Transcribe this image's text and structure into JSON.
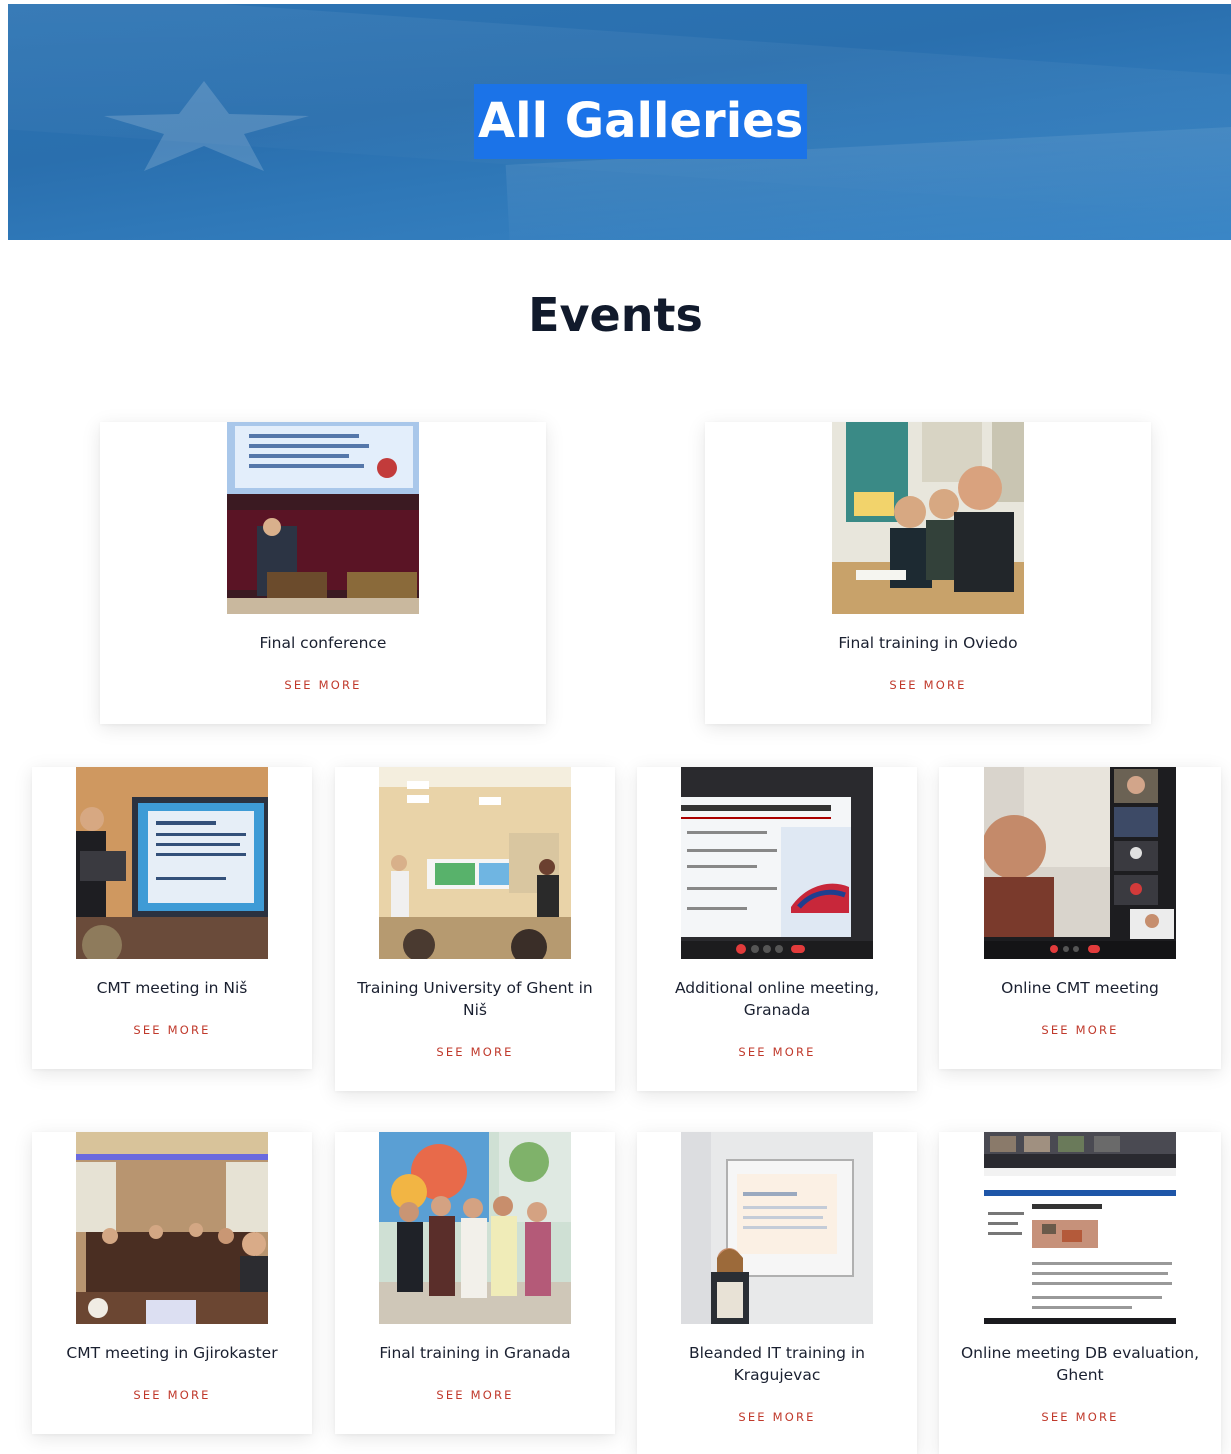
{
  "hero": {
    "title": "All Galleries"
  },
  "section": {
    "title": "Events"
  },
  "events": [
    {
      "title": "Final conference",
      "link": "SEE MORE",
      "image_icon": "conference-photo"
    },
    {
      "title": "Final training in Oviedo",
      "link": "SEE MORE",
      "image_icon": "group-photo"
    },
    {
      "title": "CMT meeting in Niš",
      "link": "SEE MORE",
      "image_icon": "presentation-photo"
    },
    {
      "title": "Training University of Ghent in Niš",
      "link": "SEE MORE",
      "image_icon": "classroom-photo"
    },
    {
      "title": "Additional online meeting, Granada",
      "link": "SEE MORE",
      "image_icon": "screen-share-photo"
    },
    {
      "title": "Online CMT meeting",
      "link": "SEE MORE",
      "image_icon": "video-call-photo"
    },
    {
      "title": "CMT meeting in Gjirokaster",
      "link": "SEE MORE",
      "image_icon": "meeting-room-photo"
    },
    {
      "title": "Final training in Granada",
      "link": "SEE MORE",
      "image_icon": "group-photo"
    },
    {
      "title": "Bleanded IT training in Kragujevac",
      "link": "SEE MORE",
      "image_icon": "projector-photo"
    },
    {
      "title": "Online meeting DB evaluation, Ghent",
      "link": "SEE MORE",
      "image_icon": "browser-screenshot"
    }
  ],
  "colors": {
    "banner": "#2d74b3",
    "title_highlight": "#1b73e8",
    "link": "#c0392b"
  }
}
